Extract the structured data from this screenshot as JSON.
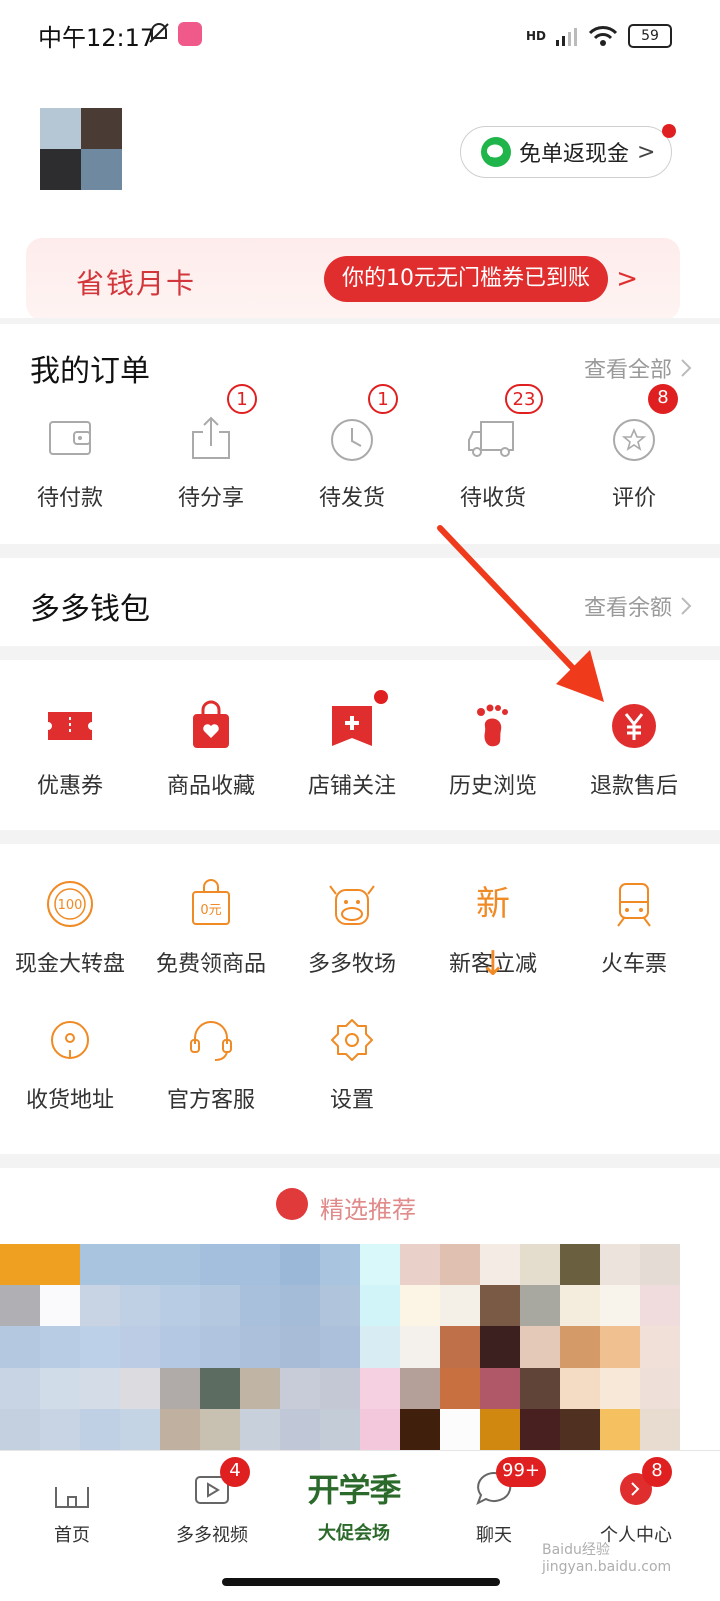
{
  "status": {
    "time": "中午12:17",
    "network": "HD",
    "battery": "59"
  },
  "cashback": {
    "label": "免单返现金",
    "chevron": ">"
  },
  "money_card": {
    "title": "省钱月卡",
    "coupon_text": "你的10元无门槛券已到账",
    "chevron": ">"
  },
  "orders": {
    "title": "我的订单",
    "view_all": "查看全部",
    "items": [
      {
        "label": "待付款",
        "icon": "wallet-icon",
        "badge": ""
      },
      {
        "label": "待分享",
        "icon": "share-icon",
        "badge": "1"
      },
      {
        "label": "待发货",
        "icon": "clock-icon",
        "badge": "1"
      },
      {
        "label": "待收货",
        "icon": "truck-icon",
        "badge": "23"
      },
      {
        "label": "评价",
        "icon": "review-icon",
        "badge": "8"
      }
    ]
  },
  "wallet": {
    "title": "多多钱包",
    "view_balance": "查看余额"
  },
  "shortcuts": [
    {
      "label": "优惠券",
      "icon": "coupon-icon"
    },
    {
      "label": "商品收藏",
      "icon": "favorites-bag-icon"
    },
    {
      "label": "店铺关注",
      "icon": "store-follow-icon"
    },
    {
      "label": "历史浏览",
      "icon": "footprint-icon"
    },
    {
      "label": "退款售后",
      "icon": "refund-yen-icon"
    }
  ],
  "services": [
    {
      "label": "现金大转盘",
      "icon": "wheel-100-icon"
    },
    {
      "label": "免费领商品",
      "icon": "free-bag-icon"
    },
    {
      "label": "多多牧场",
      "icon": "cow-icon"
    },
    {
      "label": "新客立减",
      "icon": "new-customer-icon"
    },
    {
      "label": "火车票",
      "icon": "train-icon"
    },
    {
      "label": "收货地址",
      "icon": "location-icon"
    },
    {
      "label": "官方客服",
      "icon": "headset-icon"
    },
    {
      "label": "设置",
      "icon": "settings-icon"
    }
  ],
  "services_text": {
    "new_glyph": "新↓",
    "zero_yuan": "0元",
    "hundred": "100"
  },
  "recommend": {
    "label": "精选推荐"
  },
  "tabs": [
    {
      "label": "首页",
      "icon": "home-icon",
      "badge": ""
    },
    {
      "label": "多多视频",
      "icon": "video-icon",
      "badge": "4"
    },
    {
      "label": "大促会场",
      "icon": "promo-icon",
      "badge": "",
      "banner": "开学季"
    },
    {
      "label": "聊天",
      "icon": "chat-icon",
      "badge": "99+"
    },
    {
      "label": "个人中心",
      "icon": "profile-icon",
      "badge": "8"
    }
  ],
  "colors": {
    "accent": "#e02e2e",
    "orange": "#f08a24",
    "wechat": "#20b54a"
  },
  "watermark": "Baidu经验 jingyan.baidu.com"
}
